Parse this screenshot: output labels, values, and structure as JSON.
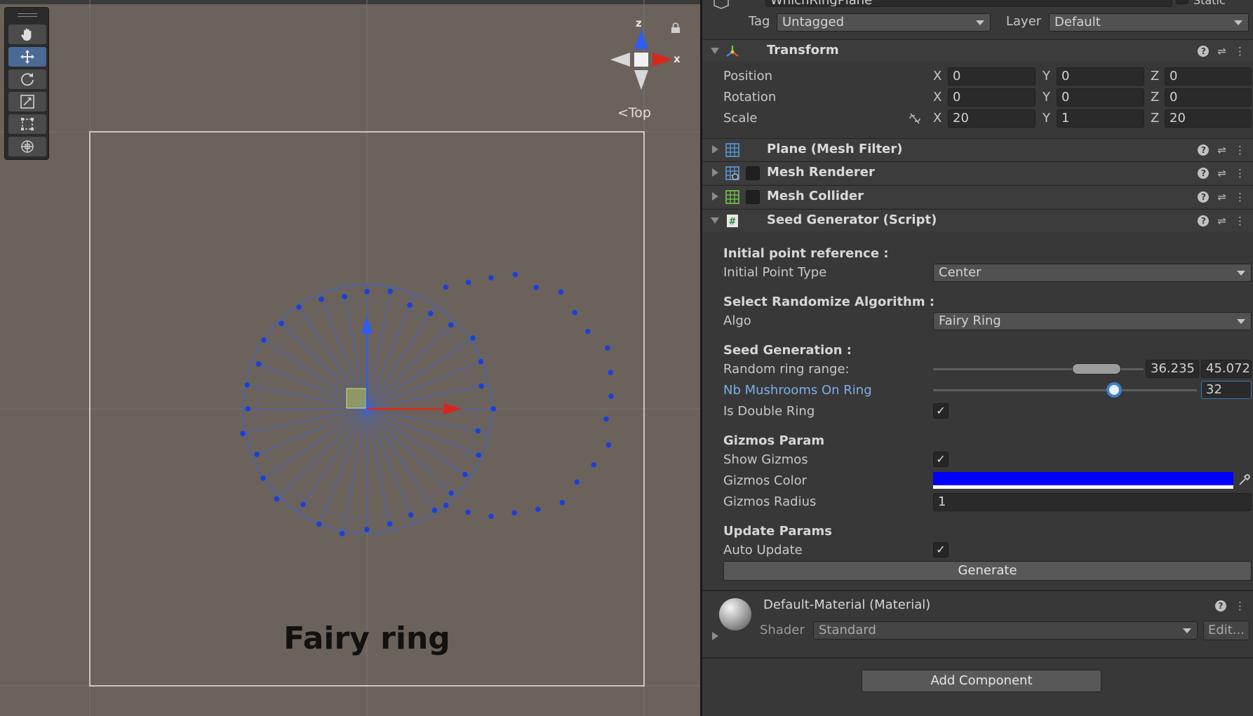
{
  "scene": {
    "view_label": "Top",
    "gizmo_axes": {
      "x": "x",
      "z": "z"
    },
    "caption": "Fairy ring",
    "colors": {
      "background": "#6b625b",
      "ring": "#3f63c8",
      "dots": "#1a40d8",
      "x_axis": "#d9261c",
      "z_axis": "#2d5ef0"
    },
    "tools": [
      {
        "name": "hand-tool",
        "icon": "hand-icon",
        "active": false
      },
      {
        "name": "move-tool",
        "icon": "move-icon",
        "active": true
      },
      {
        "name": "rotate-tool",
        "icon": "rotate-icon",
        "active": false
      },
      {
        "name": "scale-tool",
        "icon": "scale-icon",
        "active": false
      },
      {
        "name": "rect-tool",
        "icon": "rect-icon",
        "active": false
      },
      {
        "name": "transform-tool",
        "icon": "transform-icon",
        "active": false
      }
    ]
  },
  "inspector": {
    "object_name": "WhichRingPlane",
    "static_label": "Static",
    "tag_label": "Tag",
    "tag_value": "Untagged",
    "layer_label": "Layer",
    "layer_value": "Default",
    "transform": {
      "title": "Transform",
      "position": {
        "label": "Position",
        "x": "0",
        "y": "0",
        "z": "0"
      },
      "rotation": {
        "label": "Rotation",
        "x": "0",
        "y": "0",
        "z": "0"
      },
      "scale": {
        "label": "Scale",
        "x": "20",
        "y": "1",
        "z": "20"
      },
      "axis": {
        "x": "X",
        "y": "Y",
        "z": "Z"
      }
    },
    "components": {
      "mesh_filter": "Plane (Mesh Filter)",
      "mesh_renderer": "Mesh Renderer",
      "mesh_collider": "Mesh Collider",
      "seed_generator": "Seed Generator (Script)"
    },
    "seed": {
      "initial_header": "Initial point reference :",
      "initial_type_label": "Initial Point Type",
      "initial_type_value": "Center",
      "algo_header": "Select Randomize Algorithm :",
      "algo_label": "Algo",
      "algo_value": "Fairy Ring",
      "generation_header": "Seed Generation :",
      "ring_range_label": "Random ring range:",
      "ring_range_min": "36.235",
      "ring_range_max": "45.072",
      "nb_label": "Nb Mushrooms On Ring",
      "nb_value": "32",
      "double_label": "Is Double Ring",
      "gizmos_header": "Gizmos Param",
      "show_gizmos_label": "Show Gizmos",
      "gizmos_color_label": "Gizmos Color",
      "gizmos_color": "#0000ff",
      "gizmos_radius_label": "Gizmos Radius",
      "gizmos_radius_value": "1",
      "update_header": "Update Params",
      "auto_update_label": "Auto Update",
      "generate_label": "Generate"
    },
    "material": {
      "title": "Default-Material (Material)",
      "shader_label": "Shader",
      "shader_value": "Standard",
      "edit_label": "Edit..."
    },
    "add_component_label": "Add Component"
  }
}
